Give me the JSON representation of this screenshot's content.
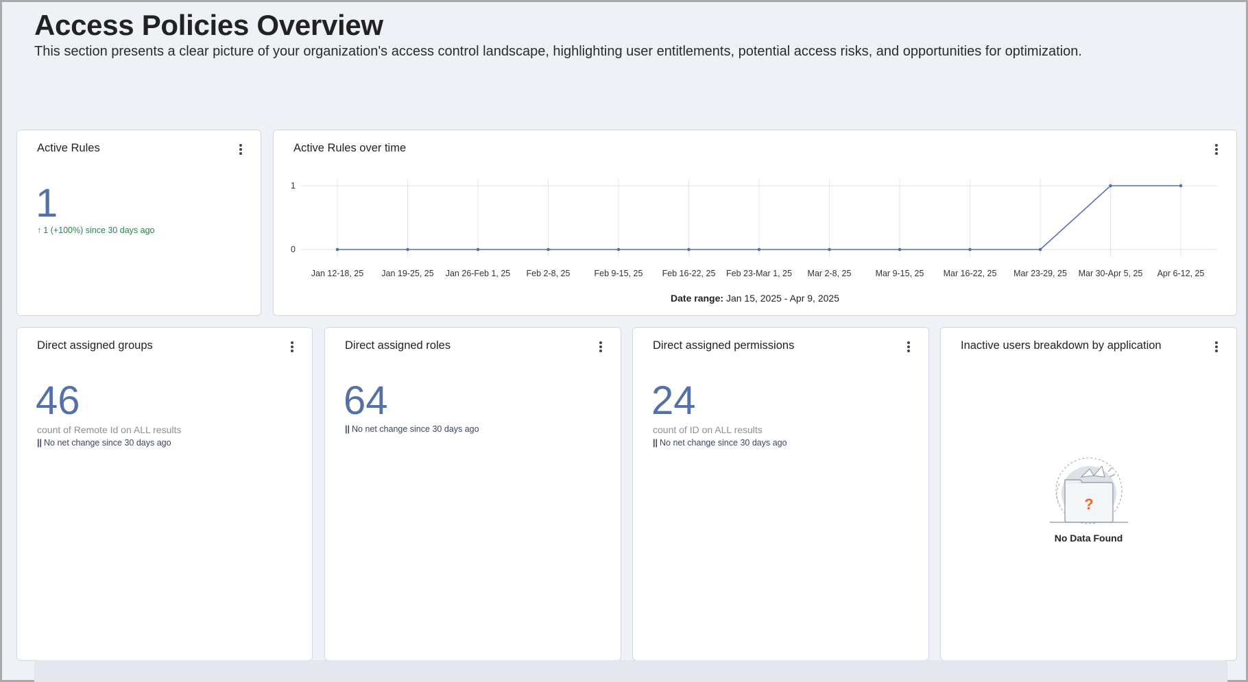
{
  "header": {
    "title": "Access Policies Overview",
    "description": "This section presents a clear picture of your organization's access control landscape, highlighting user entitlements, potential access risks, and opportunities for optimization."
  },
  "active_rules": {
    "title": "Active Rules",
    "value": "1",
    "trend_icon": "arrow-up-icon",
    "trend": "1 (+100%) since 30 days ago"
  },
  "rules_over_time": {
    "title": "Active Rules over time",
    "date_range_label": "Date range:",
    "date_range_value": "Jan 15, 2025 - Apr 9, 2025"
  },
  "direct_groups": {
    "title": "Direct assigned groups",
    "value": "46",
    "subtitle": "count of Remote Id on ALL results",
    "trend_icon": "||",
    "trend": "No net change since 30 days ago"
  },
  "direct_roles": {
    "title": "Direct assigned roles",
    "value": "64",
    "trend_icon": "||",
    "trend": "No net change since 30 days ago"
  },
  "direct_permissions": {
    "title": "Direct assigned permissions",
    "value": "24",
    "subtitle": "count of ID on ALL results",
    "trend_icon": "||",
    "trend": "No net change since 30 days ago"
  },
  "inactive_users": {
    "title": "Inactive users breakdown by application",
    "empty_icon": "empty-folder-icon",
    "empty_label": "No Data Found"
  },
  "colors": {
    "accent": "#5570a8",
    "trend_up": "#1e8a4c",
    "empty_question": "#f26722"
  },
  "chart_data": {
    "type": "line",
    "title": "Active Rules over time",
    "categories": [
      "Jan 12-18, 25",
      "Jan 19-25, 25",
      "Jan 26-Feb 1, 25",
      "Feb 2-8, 25",
      "Feb 9-15, 25",
      "Feb 16-22, 25",
      "Feb 23-Mar 1, 25",
      "Mar 2-8, 25",
      "Mar 9-15, 25",
      "Mar 16-22, 25",
      "Mar 23-29, 25",
      "Mar 30-Apr 5, 25",
      "Apr 6-12, 25"
    ],
    "series": [
      {
        "values": [
          0,
          0,
          0,
          0,
          0,
          0,
          0,
          0,
          0,
          0,
          0,
          1,
          1
        ]
      }
    ],
    "yticks": [
      "0",
      "1"
    ],
    "ylim": [
      0,
      1
    ],
    "grid": true,
    "legend": "none"
  }
}
